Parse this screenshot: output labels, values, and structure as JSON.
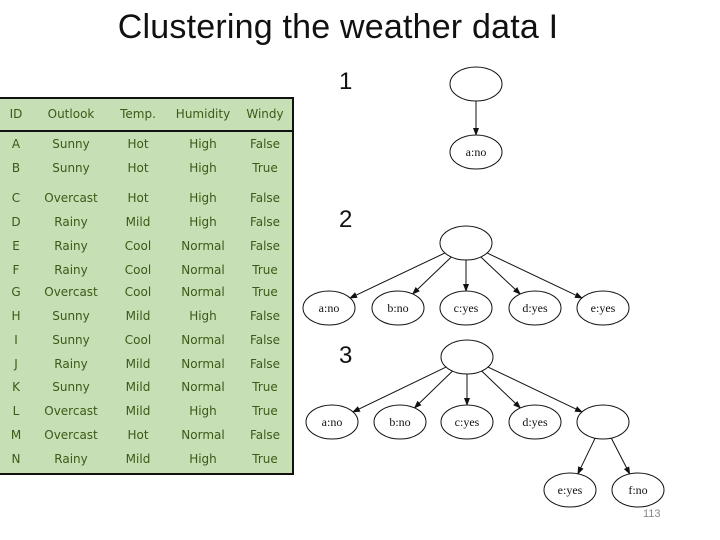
{
  "title": "Clustering the weather data I",
  "page_number": "113",
  "table": {
    "columns": [
      "ID",
      "Outlook",
      "Temp.",
      "Humidity",
      "Windy"
    ],
    "rows": [
      [
        "A",
        "Sunny",
        "Hot",
        "High",
        "False"
      ],
      [
        "B",
        "Sunny",
        "Hot",
        "High",
        "True"
      ],
      [
        "C",
        "Overcast",
        "Hot",
        "High",
        "False"
      ],
      [
        "D",
        "Rainy",
        "Mild",
        "High",
        "False"
      ],
      [
        "E",
        "Rainy",
        "Cool",
        "Normal",
        "False"
      ],
      [
        "F",
        "Rainy",
        "Cool",
        "Normal",
        "True"
      ],
      [
        "G",
        "Overcast",
        "Cool",
        "Normal",
        "True"
      ],
      [
        "H",
        "Sunny",
        "Mild",
        "High",
        "False"
      ],
      [
        "I",
        "Sunny",
        "Cool",
        "Normal",
        "False"
      ],
      [
        "J",
        "Rainy",
        "Mild",
        "Normal",
        "False"
      ],
      [
        "K",
        "Sunny",
        "Mild",
        "Normal",
        "True"
      ],
      [
        "L",
        "Overcast",
        "Mild",
        "High",
        "True"
      ],
      [
        "M",
        "Overcast",
        "Hot",
        "Normal",
        "False"
      ],
      [
        "N",
        "Rainy",
        "Mild",
        "High",
        "True"
      ]
    ]
  },
  "steps": [
    {
      "label": "1",
      "nodes": [
        {
          "id": "root",
          "label": ""
        },
        {
          "id": "a",
          "label": "a:no"
        }
      ],
      "edges": [
        [
          "root",
          "a"
        ]
      ]
    },
    {
      "label": "2",
      "nodes": [
        {
          "id": "root",
          "label": ""
        },
        {
          "id": "a",
          "label": "a:no"
        },
        {
          "id": "b",
          "label": "b:no"
        },
        {
          "id": "c",
          "label": "c:yes"
        },
        {
          "id": "d",
          "label": "d:yes"
        },
        {
          "id": "e",
          "label": "e:yes"
        }
      ],
      "edges": [
        [
          "root",
          "a"
        ],
        [
          "root",
          "b"
        ],
        [
          "root",
          "c"
        ],
        [
          "root",
          "d"
        ],
        [
          "root",
          "e"
        ]
      ]
    },
    {
      "label": "3",
      "nodes": [
        {
          "id": "root",
          "label": ""
        },
        {
          "id": "a",
          "label": "a:no"
        },
        {
          "id": "b",
          "label": "b:no"
        },
        {
          "id": "c",
          "label": "c:yes"
        },
        {
          "id": "d",
          "label": "d:yes"
        },
        {
          "id": "sub",
          "label": ""
        },
        {
          "id": "e",
          "label": "e:yes"
        },
        {
          "id": "f",
          "label": "f:no"
        }
      ],
      "edges": [
        [
          "root",
          "a"
        ],
        [
          "root",
          "b"
        ],
        [
          "root",
          "c"
        ],
        [
          "root",
          "d"
        ],
        [
          "root",
          "sub"
        ],
        [
          "sub",
          "e"
        ],
        [
          "sub",
          "f"
        ]
      ]
    }
  ],
  "colors": {
    "table_bg": "#c6dfb5",
    "table_text": "#3b5a17"
  }
}
